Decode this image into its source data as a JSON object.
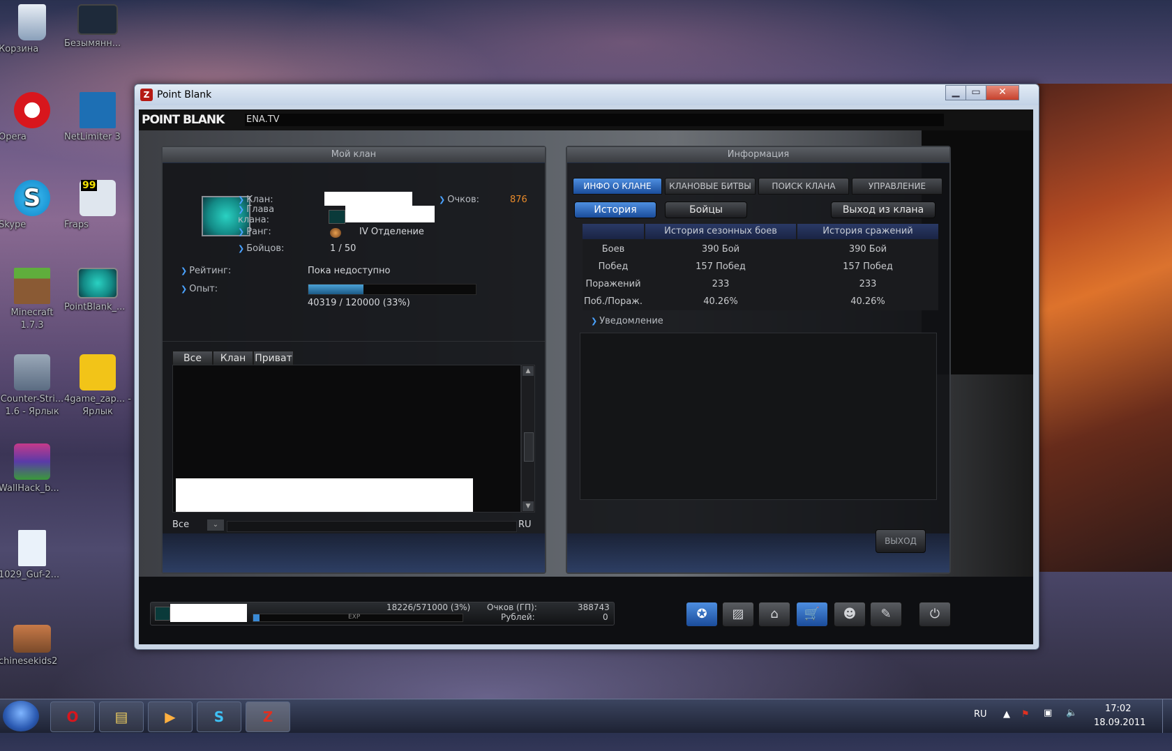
{
  "desktop": {
    "icons": [
      {
        "label": "Корзина",
        "color": "#b8c6d8"
      },
      {
        "label": "Безымянн...",
        "color": "#1e2a3a"
      },
      {
        "label": "Opera",
        "color": "#d8161d"
      },
      {
        "label": "NetLimiter 3",
        "color": "#1d6fb4"
      },
      {
        "label": "Skype",
        "color": "#1ea4e4"
      },
      {
        "label": "Fraps",
        "color": "#e6e6e6"
      },
      {
        "label": "Minecraft 1.7.3",
        "color": "#5a8c3a"
      },
      {
        "label": "PointBlank_...",
        "color": "#1a8c86"
      },
      {
        "label": "Counter-Stri... 1.6 - Ярлык",
        "color": "#5b6c82"
      },
      {
        "label": "4game_zap... - Ярлык",
        "color": "#f2c418"
      },
      {
        "label": "WallHack_b...",
        "color": "#8a3a8a"
      },
      {
        "label": "1029_Guf-2...",
        "color": "#eaf2fa"
      },
      {
        "label": "chinesekids2",
        "color": "#c87a48"
      }
    ],
    "fraps_counter": "99"
  },
  "window": {
    "title": "Point Blank",
    "app_icon": "pb-logo-icon",
    "minimize": "▁",
    "maximize": "▭",
    "close": "✕"
  },
  "game": {
    "logo": "POINT BLANK",
    "url": "ENA.TV",
    "left_panel": {
      "title": "Мой клан",
      "clan_label": "Клан:",
      "leader_label": "Глава клана:",
      "rank_label": "Ранг:",
      "rank_value": "IV Отделение",
      "fighters_label": "Бойцов:",
      "fighters_value": "1 / 50",
      "points_label": "Очков:",
      "points_value": "876",
      "rating_label": "Рейтинг:",
      "rating_value": "Пока недоступно",
      "exp_label": "Опыт:",
      "exp_text": "40319 / 120000 (33%)",
      "exp_progress": 33,
      "chat_tabs": [
        "Все",
        "Клан",
        "Приват"
      ],
      "chat_channel": "Все",
      "chat_lang": "RU"
    },
    "right_panel": {
      "title": "Информация",
      "tabs": [
        "ИНФО О КЛАНЕ",
        "КЛАНОВЫЕ БИТВЫ",
        "ПОИСК КЛАНА",
        "УПРАВЛЕНИЕ"
      ],
      "sub_buttons": [
        "История",
        "Бойцы"
      ],
      "leave_button": "Выход из клана",
      "table": {
        "headers": [
          "",
          "История сезонных боев",
          "История сражений"
        ],
        "rows": [
          [
            "Боев",
            "390  Бой",
            "390  Бой"
          ],
          [
            "Побед",
            "157 Побед",
            "157 Побед"
          ],
          [
            "Поражений",
            "233",
            "233"
          ],
          [
            "Поб./Пораж.",
            "40.26%",
            "40.26%"
          ]
        ]
      },
      "notification_label": "Уведомление",
      "exit_button": "ВЫХОД"
    },
    "status": {
      "exp_text": "18226/571000 (3%)",
      "exp_bar_label": "EXP",
      "exp_progress": 3,
      "gp_label": "Очков (ГП):",
      "gp_value": "388743",
      "rub_label": "Рублей:",
      "rub_value": "0"
    },
    "nav_buttons": [
      {
        "icon": "clan-emblem-icon",
        "glyph": "✪",
        "active": true
      },
      {
        "icon": "inventory-icon",
        "glyph": "▨",
        "active": false
      },
      {
        "icon": "shop-icon",
        "glyph": "⌂",
        "active": false
      },
      {
        "icon": "cart-icon",
        "glyph": "🛒",
        "active": true
      },
      {
        "icon": "friends-icon",
        "glyph": "☻",
        "active": false
      },
      {
        "icon": "settings-wrench-icon",
        "glyph": "✎",
        "active": false
      },
      {
        "icon": "power-icon",
        "glyph": "⏻",
        "active": false
      }
    ]
  },
  "taskbar": {
    "apps": [
      "opera-icon",
      "explorer-icon",
      "media-player-icon",
      "skype-icon",
      "point-blank-icon"
    ],
    "lang": "RU",
    "time": "17:02",
    "date": "18.09.2011"
  }
}
